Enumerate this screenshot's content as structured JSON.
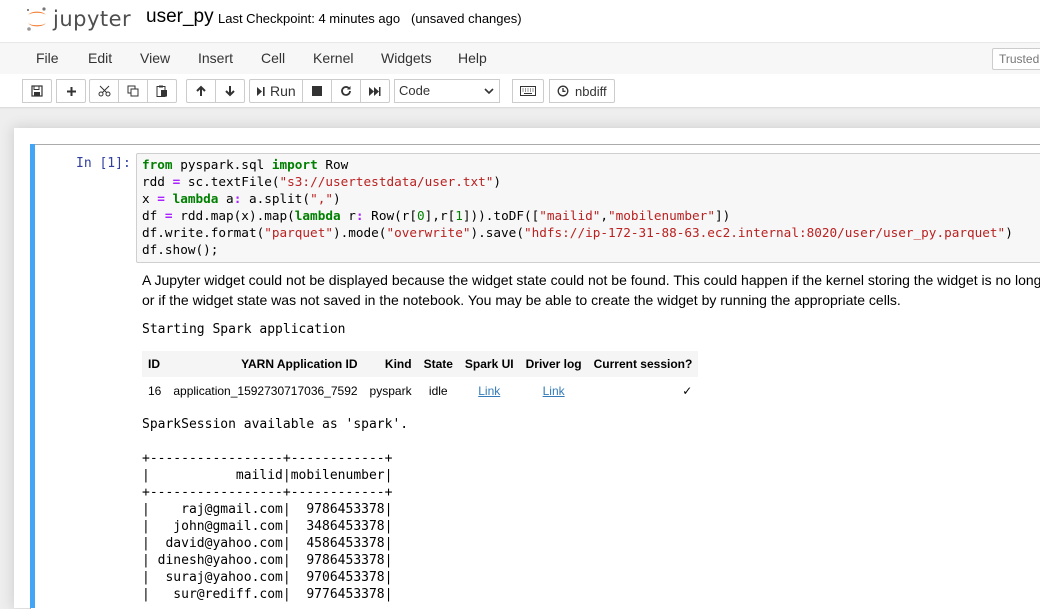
{
  "header": {
    "logo_text": "jupyter",
    "notebook_name": "user_py",
    "checkpoint": "Last Checkpoint: 4 minutes ago",
    "unsaved": "(unsaved changes)"
  },
  "menu": {
    "items": [
      "File",
      "Edit",
      "View",
      "Insert",
      "Cell",
      "Kernel",
      "Widgets",
      "Help"
    ],
    "trusted": "Trusted"
  },
  "toolbar": {
    "run_label": "Run",
    "cell_type": "Code",
    "nbdiff_label": "nbdiff",
    "icons": [
      "save-icon",
      "plus-icon",
      "cut-icon",
      "copy-icon",
      "paste-icon",
      "arrow-up-icon",
      "arrow-down-icon",
      "run-icon",
      "stop-icon",
      "restart-icon",
      "fast-forward-icon",
      "keyboard-icon",
      "history-icon"
    ]
  },
  "cell": {
    "prompt": "In [1]:",
    "code_lines": [
      "from pyspark.sql import Row",
      "rdd = sc.textFile(\"s3://usertestdata/user.txt\")",
      "x = lambda a: a.split(\",\")",
      "df = rdd.map(x).map(lambda r: Row(r[0],r[1])).toDF([\"mailid\",\"mobilenumber\"])",
      "df.write.format(\"parquet\").mode(\"overwrite\").save(\"hdfs://ip-172-31-88-63.ec2.internal:8020/user/user_py.parquet\")",
      "df.show();"
    ]
  },
  "output": {
    "widget_message_1": "A Jupyter widget could not be displayed because the widget state could not be found. This could happen if the kernel storing the widget is no long",
    "widget_message_2": "or if the widget state was not saved in the notebook. You may be able to create the widget by running the appropriate cells.",
    "starting": "Starting Spark application",
    "session_table": {
      "headers": [
        "ID",
        "YARN Application ID",
        "Kind",
        "State",
        "Spark UI",
        "Driver log",
        "Current session?"
      ],
      "row": {
        "id": "16",
        "app_id": "application_1592730717036_7592",
        "kind": "pyspark",
        "state": "idle",
        "spark_ui": "Link",
        "driver_log": "Link",
        "current": "✓"
      }
    },
    "session_available": "SparkSession available as 'spark'.",
    "ascii_table": [
      "+-----------------+------------+",
      "|           mailid|mobilenumber|",
      "+-----------------+------------+",
      "|    raj@gmail.com|  9786453378|",
      "|   john@gmail.com|  3486453378|",
      "|  david@yahoo.com|  4586453378|",
      "| dinesh@yahoo.com|  9786453378|",
      "|  suraj@yahoo.com|  9706453378|",
      "|   sur@rediff.com|  9776453378|"
    ]
  },
  "colors": {
    "cell_selected_bar": "#42a5f5",
    "prompt": "#303f9f",
    "keyword": "#008000",
    "string": "#ba2121",
    "logo_orange": "#f37726"
  }
}
